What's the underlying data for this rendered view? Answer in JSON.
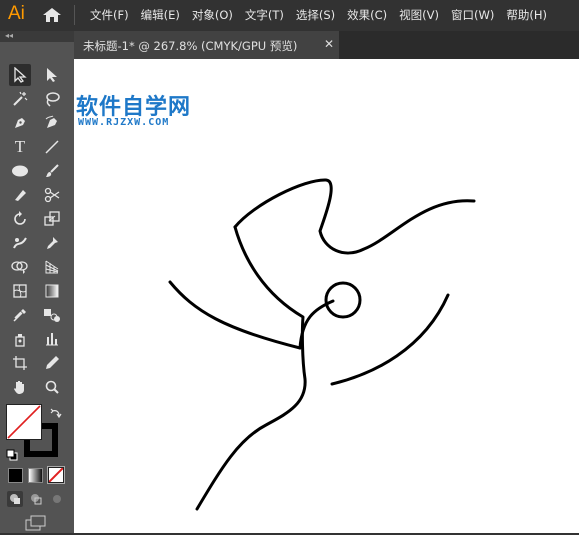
{
  "app": {
    "logo": "Ai"
  },
  "menu": [
    "文件(F)",
    "编辑(E)",
    "对象(O)",
    "文字(T)",
    "选择(S)",
    "效果(C)",
    "视图(V)",
    "窗口(W)",
    "帮助(H)"
  ],
  "document_tab": {
    "title": "未标题-1* @ 267.8% (CMYK/GPU 预览)",
    "close_glyph": "✕"
  },
  "toolbox": {
    "collapse_glyph": "◂◂"
  },
  "watermark": {
    "title": "软件自学网",
    "url": "WWW.RJZXW.COM"
  },
  "colors": {
    "fill": "#ffffff",
    "stroke": "#000000",
    "accent": "#ff9a00",
    "watermark": "#1e78c8"
  }
}
